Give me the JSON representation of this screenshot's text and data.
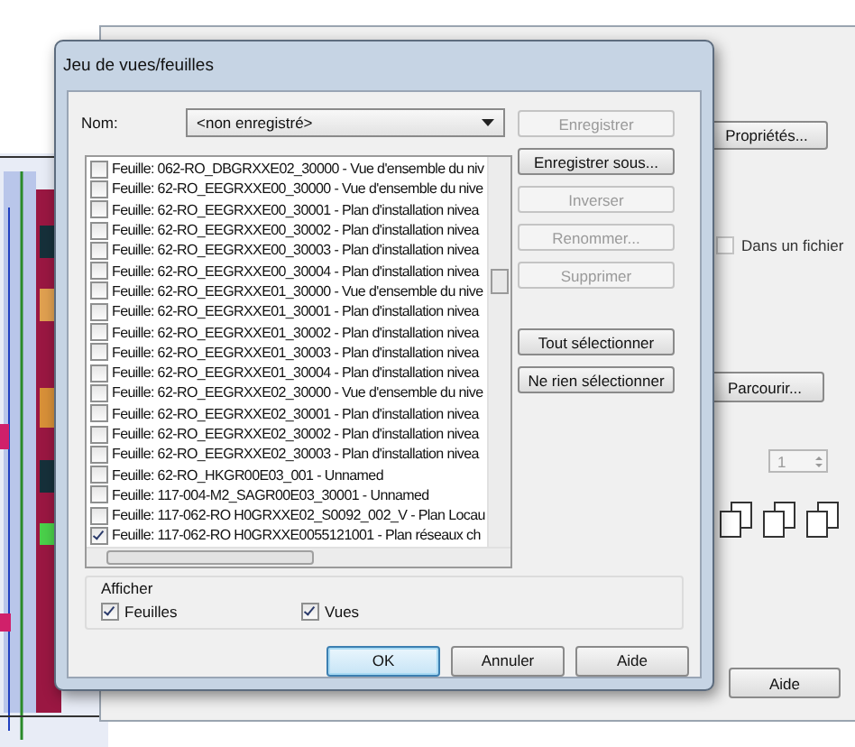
{
  "back_dialog": {
    "properties_button": "Propriétés...",
    "file_checkbox": {
      "label": "Dans un fichier",
      "checked": false
    },
    "browse_button": "Parcourir...",
    "copies_spinner": "1",
    "help_button": "Aide"
  },
  "dialog": {
    "title": "Jeu de vues/feuilles",
    "name_label": "Nom:",
    "name_value": "<non enregistré>",
    "items": [
      {
        "label": "Feuille: 062-RO_DBGRXXE02_30000 - Vue d'ensemble du niv",
        "checked": false
      },
      {
        "label": "Feuille: 62-RO_EEGRXXE00_30000 - Vue d'ensemble du nive",
        "checked": false
      },
      {
        "label": "Feuille: 62-RO_EEGRXXE00_30001 - Plan d'installation nivea",
        "checked": false
      },
      {
        "label": "Feuille: 62-RO_EEGRXXE00_30002 - Plan d'installation nivea",
        "checked": false
      },
      {
        "label": "Feuille: 62-RO_EEGRXXE00_30003 - Plan d'installation nivea",
        "checked": false
      },
      {
        "label": "Feuille: 62-RO_EEGRXXE00_30004 - Plan d'installation nivea",
        "checked": false
      },
      {
        "label": "Feuille: 62-RO_EEGRXXE01_30000 - Vue d'ensemble du nive",
        "checked": false
      },
      {
        "label": "Feuille: 62-RO_EEGRXXE01_30001 - Plan d'installation nivea",
        "checked": false
      },
      {
        "label": "Feuille: 62-RO_EEGRXXE01_30002 - Plan d'installation nivea",
        "checked": false
      },
      {
        "label": "Feuille: 62-RO_EEGRXXE01_30003 - Plan d'installation nivea",
        "checked": false
      },
      {
        "label": "Feuille: 62-RO_EEGRXXE01_30004 - Plan d'installation nivea",
        "checked": false
      },
      {
        "label": "Feuille: 62-RO_EEGRXXE02_30000 - Vue d'ensemble du nive",
        "checked": false
      },
      {
        "label": "Feuille: 62-RO_EEGRXXE02_30001 - Plan d'installation nivea",
        "checked": false
      },
      {
        "label": "Feuille: 62-RO_EEGRXXE02_30002 - Plan d'installation nivea",
        "checked": false
      },
      {
        "label": "Feuille: 62-RO_EEGRXXE02_30003 - Plan d'installation nivea",
        "checked": false
      },
      {
        "label": "Feuille: 62-RO_HKGR00E03_001 - Unnamed",
        "checked": false
      },
      {
        "label": "Feuille: 117-004-M2_SAGR00E03_30001 - Unnamed",
        "checked": false
      },
      {
        "label": "Feuille: 117-062-RO H0GRXXE02_S0092_002_V - Plan Locau",
        "checked": false
      },
      {
        "label": "Feuille: 117-062-RO H0GRXXE0055121001 - Plan réseaux ch",
        "checked": true
      }
    ],
    "actions": [
      {
        "label": "Enregistrer",
        "disabled": true
      },
      {
        "label": "Enregistrer sous...",
        "disabled": false
      },
      {
        "label": "Inverser",
        "disabled": true
      },
      {
        "label": "Renommer...",
        "disabled": true
      },
      {
        "label": "Supprimer",
        "disabled": true
      },
      {
        "label": "Tout sélectionner",
        "disabled": false
      },
      {
        "label": "Ne rien sélectionner",
        "disabled": false
      }
    ],
    "show_group": {
      "title": "Afficher",
      "options": [
        {
          "label": "Feuilles",
          "checked": true
        },
        {
          "label": "Vues",
          "checked": true
        }
      ]
    },
    "buttons": [
      {
        "label": "OK",
        "default": true
      },
      {
        "label": "Annuler",
        "default": false
      },
      {
        "label": "Aide",
        "default": false
      }
    ]
  }
}
